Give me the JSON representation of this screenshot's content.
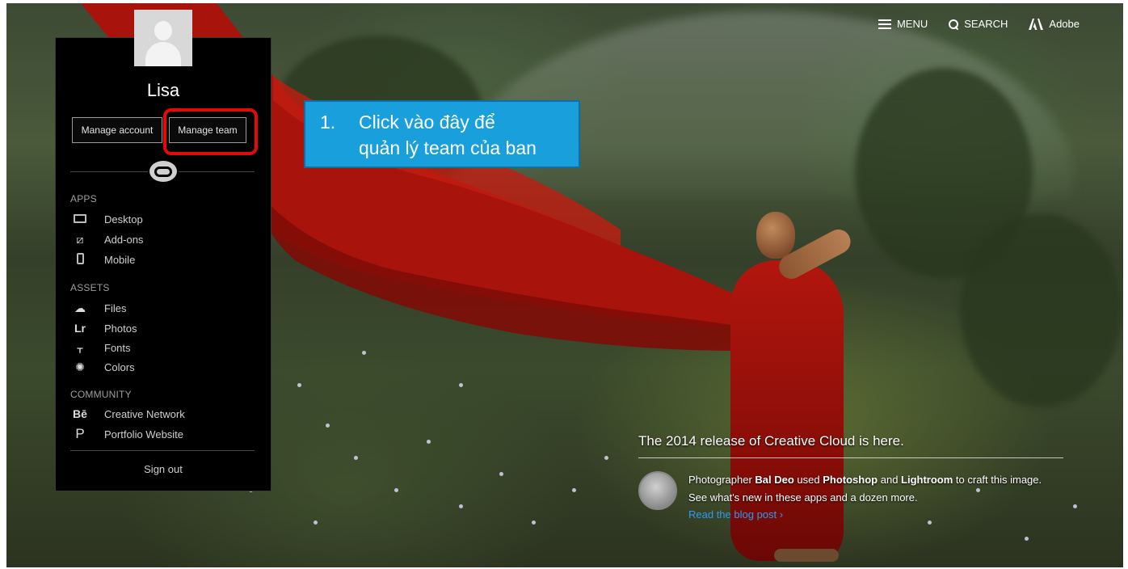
{
  "nav": {
    "menu_label": "MENU",
    "search_label": "SEARCH",
    "brand_label": "Adobe"
  },
  "account": {
    "username": "Lisa",
    "manage_account_label": "Manage account",
    "manage_team_label": "Manage team",
    "sections": {
      "apps_label": "APPS",
      "assets_label": "ASSETS",
      "community_label": "COMMUNITY"
    },
    "apps": [
      "Desktop",
      "Add-ons",
      "Mobile"
    ],
    "assets": [
      "Files",
      "Photos",
      "Fonts",
      "Colors"
    ],
    "community": [
      "Creative Network",
      "Portfolio Website"
    ],
    "sign_out_label": "Sign out"
  },
  "annotation": {
    "number": "1.",
    "text": "Click vào đây để\nquản lý team của ban"
  },
  "promo": {
    "title": "The 2014 release of Creative Cloud is here.",
    "body_prefix": "Photographer ",
    "photographer": "Bal Deo",
    "body_used": " used ",
    "app1": "Photoshop",
    "body_and": " and ",
    "app2": "Lightroom",
    "body_suffix": " to craft this image. See what's new in these apps and a dozen more.",
    "link": "Read the blog post ›"
  },
  "colors": {
    "highlight": "#e40a0a",
    "annotation_bg": "#189fdc",
    "link": "#2b9bf3",
    "robe": "#b2160e"
  }
}
